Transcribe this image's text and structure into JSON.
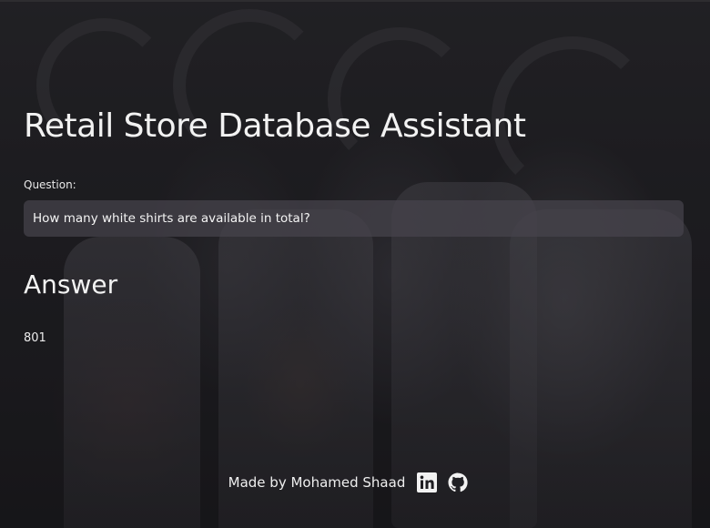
{
  "app": {
    "title": "Retail Store Database Assistant"
  },
  "question": {
    "label": "Question:",
    "value": "How many white shirts are available in total?"
  },
  "answer": {
    "heading": "Answer",
    "value": "801"
  },
  "footer": {
    "text": "Made by Mohamed Shaad",
    "icons": [
      "linkedin-icon",
      "github-icon"
    ]
  },
  "colors": {
    "text": "#f2f2f2",
    "input_bg": "#46444c",
    "background": "#1f1e22"
  }
}
